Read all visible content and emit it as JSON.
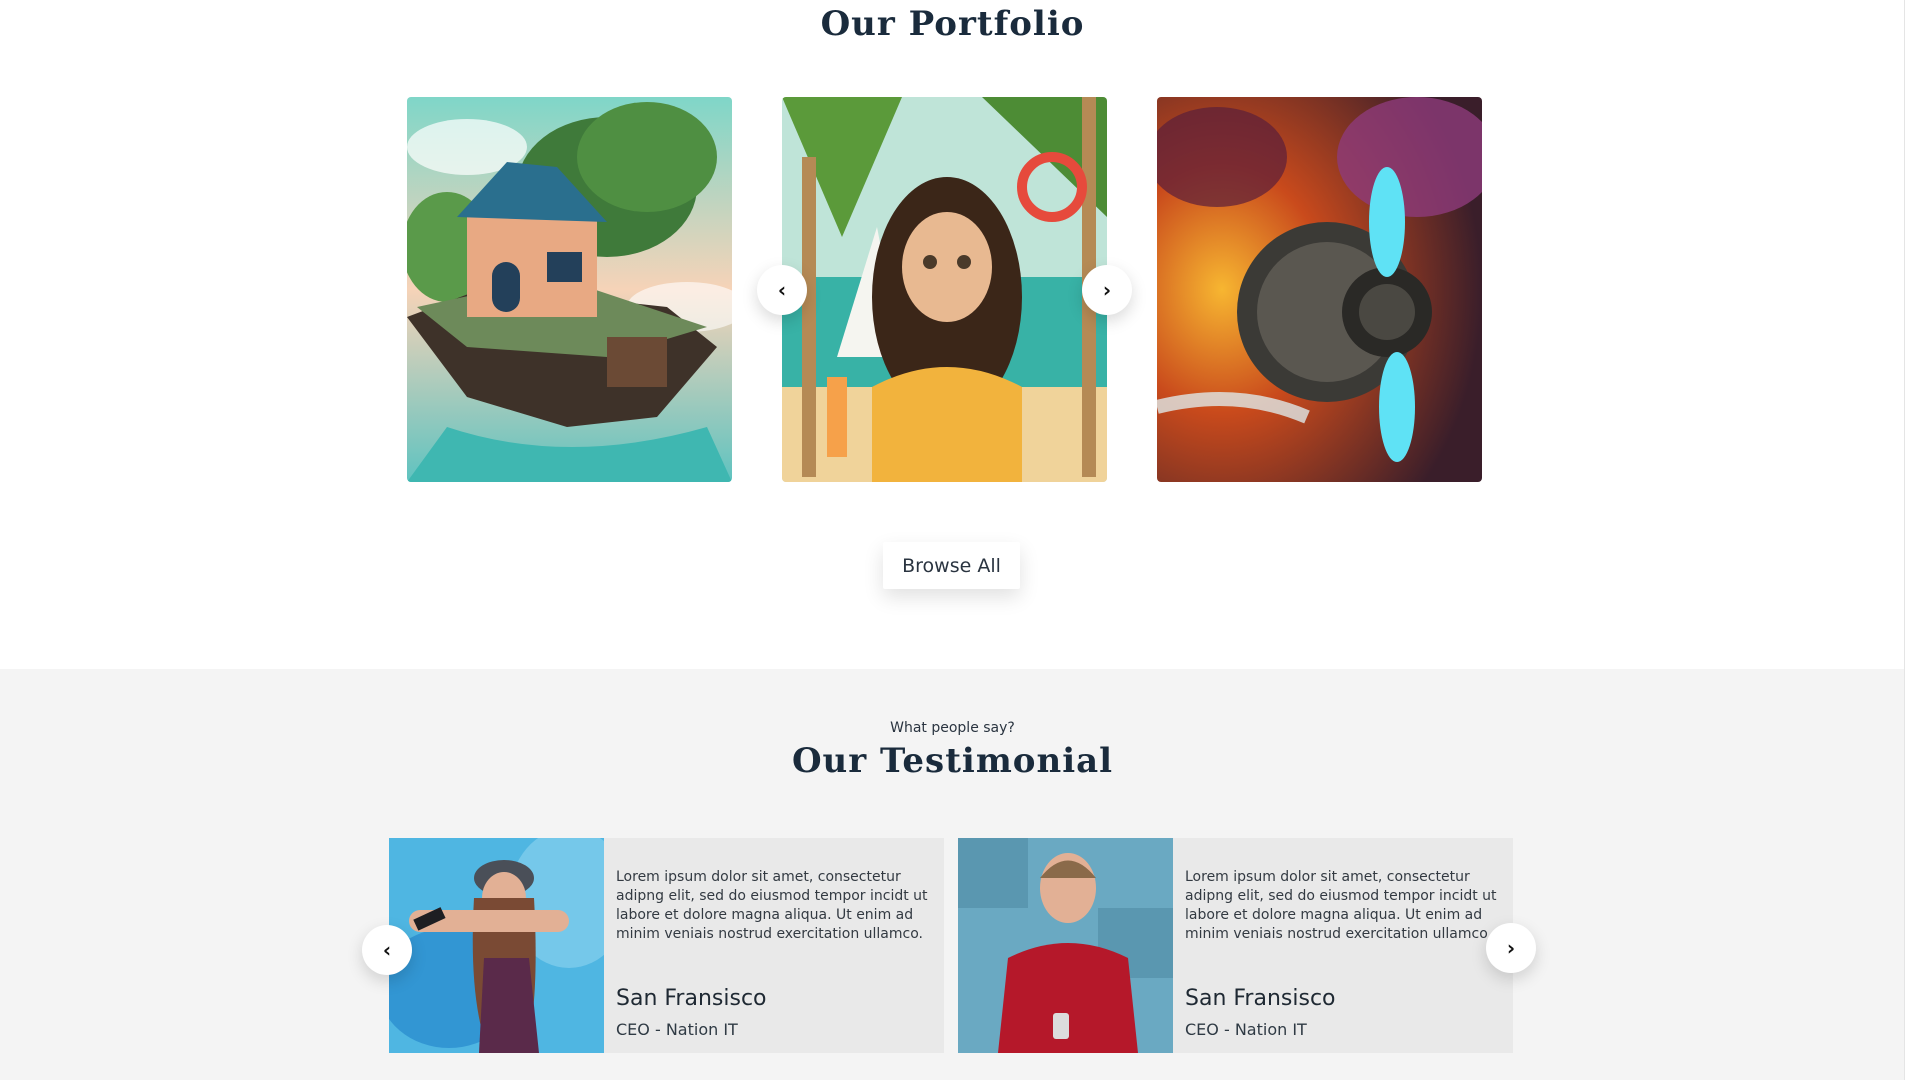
{
  "portfolio": {
    "title": "Our Portfolio",
    "items": [
      {
        "label": "Floating island house illustration"
      },
      {
        "label": "Girl at the beach illustration"
      },
      {
        "label": "Steampunk propeller engine illustration"
      }
    ],
    "prev_icon": "chevron-left-icon",
    "next_icon": "chevron-right-icon",
    "prev_glyph": "‹",
    "next_glyph": "›",
    "browse_label": "Browse All"
  },
  "testimonial": {
    "subtitle": "What people say?",
    "title": "Our Testimonial",
    "cards": [
      {
        "quote": "Lorem ipsum dolor sit amet, consectetur adipng elit, sed do eiusmod tempor incidt ut labore et dolore magna aliqua. Ut enim ad minim veniais nostrud exercitation ullamco.",
        "name": "San Fransisco",
        "role": "CEO - Nation IT"
      },
      {
        "quote": "Lorem ipsum dolor sit amet, consectetur adipng elit, sed do eiusmod tempor incidt ut labore et dolore magna aliqua. Ut enim ad minim veniais nostrud exercitation ullamco.",
        "name": "San Fransisco",
        "role": "CEO - Nation IT"
      }
    ],
    "prev_glyph": "‹",
    "next_glyph": "›"
  },
  "colors": {
    "heading": "#1a2b3c",
    "testimonial_bg": "#f4f4f4",
    "card_bg": "#e9e9e9"
  }
}
